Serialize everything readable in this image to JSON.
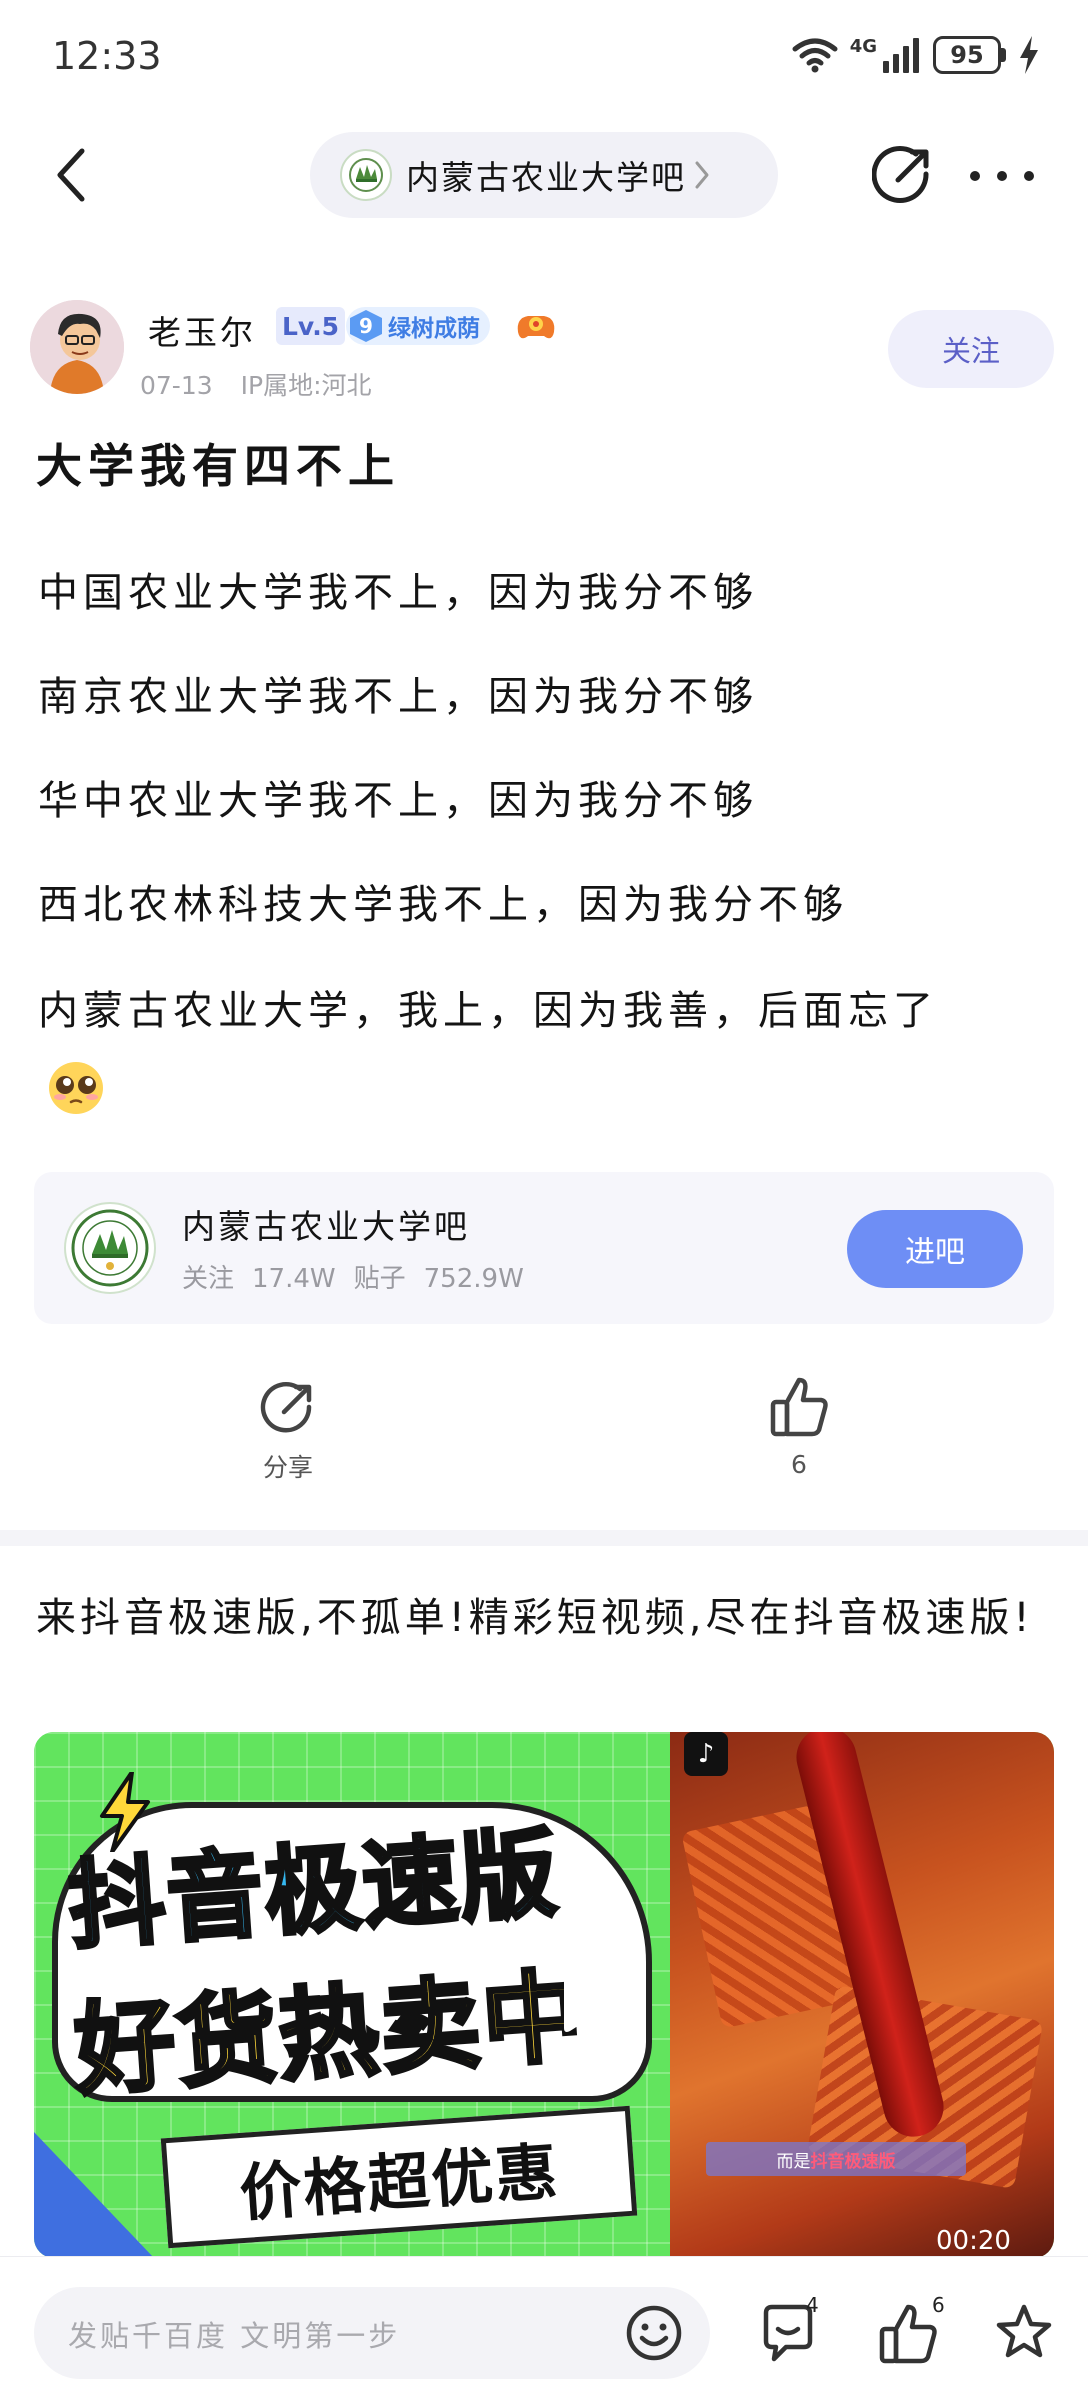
{
  "status_bar": {
    "time": "12:33",
    "network": "4G",
    "battery": "95"
  },
  "nav": {
    "forum_name": "内蒙古农业大学吧"
  },
  "author": {
    "name": "老玉尔",
    "level": "Lv.5",
    "honor_level": "9",
    "honor_title": "绿树成荫",
    "date": "07-13",
    "ip_location": "IP属地:河北",
    "follow_label": "关注"
  },
  "post": {
    "title": "大学我有四不上",
    "lines": [
      "中国农业大学我不上，因为我分不够",
      "南京农业大学我不上，因为我分不够",
      "华中农业大学我不上，因为我分不够",
      "西北农林科技大学我不上，因为我分不够",
      "内蒙古农业大学，我上，因为我善，后面忘了"
    ]
  },
  "forum_card": {
    "name": "内蒙古农业大学吧",
    "followers_label": "关注",
    "followers": "17.4W",
    "posts_label": "贴子",
    "posts": "752.9W",
    "enter_label": "进吧"
  },
  "actions": {
    "share_label": "分享",
    "like_count": "6"
  },
  "ad": {
    "text": "来抖音极速版,不孤单!精彩短视频,尽在抖音极速版!",
    "banner_line1": "抖音极速版",
    "banner_line2": "好货热卖中",
    "banner_line3": "价格超优惠",
    "caption_prefix": "而是",
    "caption_highlight": "抖音极速版",
    "duration": "00:20"
  },
  "bottom_bar": {
    "reply_placeholder": "发贴千百度 文明第一步",
    "comment_count": "4",
    "like_count": "6"
  },
  "colors": {
    "accent": "#6e8ef5",
    "follow_text": "#5b5fc7",
    "card_bg": "#f6f6fb"
  }
}
